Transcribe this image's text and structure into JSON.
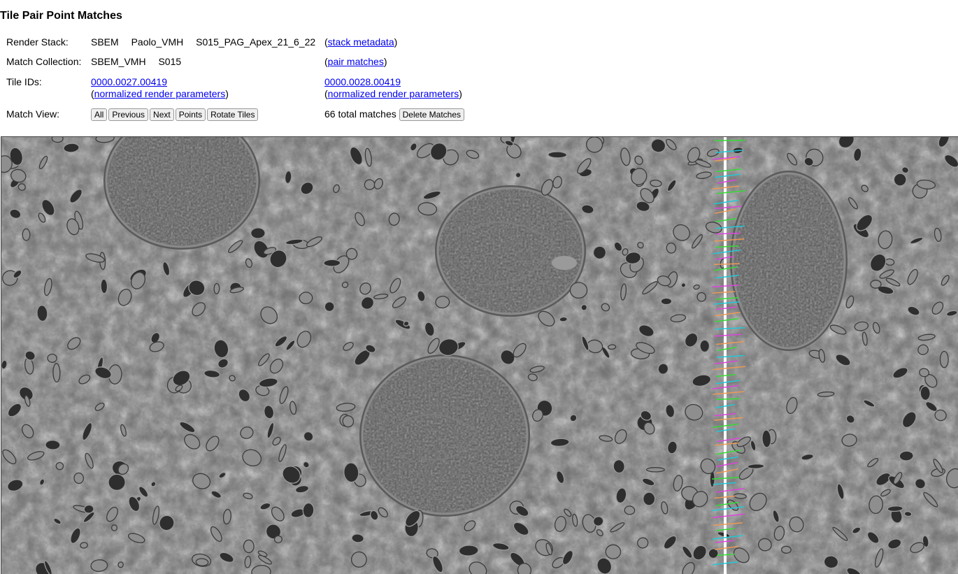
{
  "page": {
    "title": "Tile Pair Point Matches"
  },
  "render_stack": {
    "label": "Render Stack:",
    "owner": "SBEM",
    "project": "Paolo_VMH",
    "stack": "S015_PAG_Apex_21_6_22",
    "link_prefix": "(",
    "link_text": "stack metadata",
    "link_suffix": ")"
  },
  "match_collection": {
    "label": "Match Collection:",
    "owner": "SBEM_VMH",
    "name": "S015",
    "link_prefix": "(",
    "link_text": "pair matches",
    "link_suffix": ")"
  },
  "tile_ids": {
    "label": "Tile IDs:",
    "p_id": "0000.0027.00419",
    "q_id": "0000.0028.00419",
    "params_prefix": "(",
    "params_link": "normalized render parameters",
    "params_suffix": ")"
  },
  "match_view": {
    "label": "Match View:",
    "buttons": [
      "All",
      "Previous",
      "Next",
      "Points",
      "Rotate Tiles"
    ],
    "total_text": "66 total matches",
    "delete_label": "Delete Matches"
  },
  "viewer": {
    "boundary_color": "#ffffff",
    "background_color": "#6e6e6e",
    "match_colors": [
      "#33dd33",
      "#22c8d8",
      "#dd44dd",
      "#ee9955"
    ],
    "match_count": 66
  }
}
